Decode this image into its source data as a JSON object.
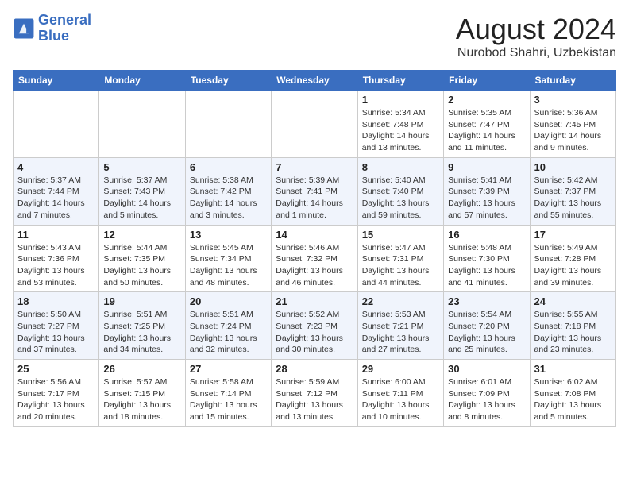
{
  "header": {
    "logo_line1": "General",
    "logo_line2": "Blue",
    "month": "August 2024",
    "location": "Nurobod Shahri, Uzbekistan"
  },
  "weekdays": [
    "Sunday",
    "Monday",
    "Tuesday",
    "Wednesday",
    "Thursday",
    "Friday",
    "Saturday"
  ],
  "weeks": [
    [
      {
        "day": "",
        "detail": ""
      },
      {
        "day": "",
        "detail": ""
      },
      {
        "day": "",
        "detail": ""
      },
      {
        "day": "",
        "detail": ""
      },
      {
        "day": "1",
        "detail": "Sunrise: 5:34 AM\nSunset: 7:48 PM\nDaylight: 14 hours\nand 13 minutes."
      },
      {
        "day": "2",
        "detail": "Sunrise: 5:35 AM\nSunset: 7:47 PM\nDaylight: 14 hours\nand 11 minutes."
      },
      {
        "day": "3",
        "detail": "Sunrise: 5:36 AM\nSunset: 7:45 PM\nDaylight: 14 hours\nand 9 minutes."
      }
    ],
    [
      {
        "day": "4",
        "detail": "Sunrise: 5:37 AM\nSunset: 7:44 PM\nDaylight: 14 hours\nand 7 minutes."
      },
      {
        "day": "5",
        "detail": "Sunrise: 5:37 AM\nSunset: 7:43 PM\nDaylight: 14 hours\nand 5 minutes."
      },
      {
        "day": "6",
        "detail": "Sunrise: 5:38 AM\nSunset: 7:42 PM\nDaylight: 14 hours\nand 3 minutes."
      },
      {
        "day": "7",
        "detail": "Sunrise: 5:39 AM\nSunset: 7:41 PM\nDaylight: 14 hours\nand 1 minute."
      },
      {
        "day": "8",
        "detail": "Sunrise: 5:40 AM\nSunset: 7:40 PM\nDaylight: 13 hours\nand 59 minutes."
      },
      {
        "day": "9",
        "detail": "Sunrise: 5:41 AM\nSunset: 7:39 PM\nDaylight: 13 hours\nand 57 minutes."
      },
      {
        "day": "10",
        "detail": "Sunrise: 5:42 AM\nSunset: 7:37 PM\nDaylight: 13 hours\nand 55 minutes."
      }
    ],
    [
      {
        "day": "11",
        "detail": "Sunrise: 5:43 AM\nSunset: 7:36 PM\nDaylight: 13 hours\nand 53 minutes."
      },
      {
        "day": "12",
        "detail": "Sunrise: 5:44 AM\nSunset: 7:35 PM\nDaylight: 13 hours\nand 50 minutes."
      },
      {
        "day": "13",
        "detail": "Sunrise: 5:45 AM\nSunset: 7:34 PM\nDaylight: 13 hours\nand 48 minutes."
      },
      {
        "day": "14",
        "detail": "Sunrise: 5:46 AM\nSunset: 7:32 PM\nDaylight: 13 hours\nand 46 minutes."
      },
      {
        "day": "15",
        "detail": "Sunrise: 5:47 AM\nSunset: 7:31 PM\nDaylight: 13 hours\nand 44 minutes."
      },
      {
        "day": "16",
        "detail": "Sunrise: 5:48 AM\nSunset: 7:30 PM\nDaylight: 13 hours\nand 41 minutes."
      },
      {
        "day": "17",
        "detail": "Sunrise: 5:49 AM\nSunset: 7:28 PM\nDaylight: 13 hours\nand 39 minutes."
      }
    ],
    [
      {
        "day": "18",
        "detail": "Sunrise: 5:50 AM\nSunset: 7:27 PM\nDaylight: 13 hours\nand 37 minutes."
      },
      {
        "day": "19",
        "detail": "Sunrise: 5:51 AM\nSunset: 7:25 PM\nDaylight: 13 hours\nand 34 minutes."
      },
      {
        "day": "20",
        "detail": "Sunrise: 5:51 AM\nSunset: 7:24 PM\nDaylight: 13 hours\nand 32 minutes."
      },
      {
        "day": "21",
        "detail": "Sunrise: 5:52 AM\nSunset: 7:23 PM\nDaylight: 13 hours\nand 30 minutes."
      },
      {
        "day": "22",
        "detail": "Sunrise: 5:53 AM\nSunset: 7:21 PM\nDaylight: 13 hours\nand 27 minutes."
      },
      {
        "day": "23",
        "detail": "Sunrise: 5:54 AM\nSunset: 7:20 PM\nDaylight: 13 hours\nand 25 minutes."
      },
      {
        "day": "24",
        "detail": "Sunrise: 5:55 AM\nSunset: 7:18 PM\nDaylight: 13 hours\nand 23 minutes."
      }
    ],
    [
      {
        "day": "25",
        "detail": "Sunrise: 5:56 AM\nSunset: 7:17 PM\nDaylight: 13 hours\nand 20 minutes."
      },
      {
        "day": "26",
        "detail": "Sunrise: 5:57 AM\nSunset: 7:15 PM\nDaylight: 13 hours\nand 18 minutes."
      },
      {
        "day": "27",
        "detail": "Sunrise: 5:58 AM\nSunset: 7:14 PM\nDaylight: 13 hours\nand 15 minutes."
      },
      {
        "day": "28",
        "detail": "Sunrise: 5:59 AM\nSunset: 7:12 PM\nDaylight: 13 hours\nand 13 minutes."
      },
      {
        "day": "29",
        "detail": "Sunrise: 6:00 AM\nSunset: 7:11 PM\nDaylight: 13 hours\nand 10 minutes."
      },
      {
        "day": "30",
        "detail": "Sunrise: 6:01 AM\nSunset: 7:09 PM\nDaylight: 13 hours\nand 8 minutes."
      },
      {
        "day": "31",
        "detail": "Sunrise: 6:02 AM\nSunset: 7:08 PM\nDaylight: 13 hours\nand 5 minutes."
      }
    ]
  ]
}
